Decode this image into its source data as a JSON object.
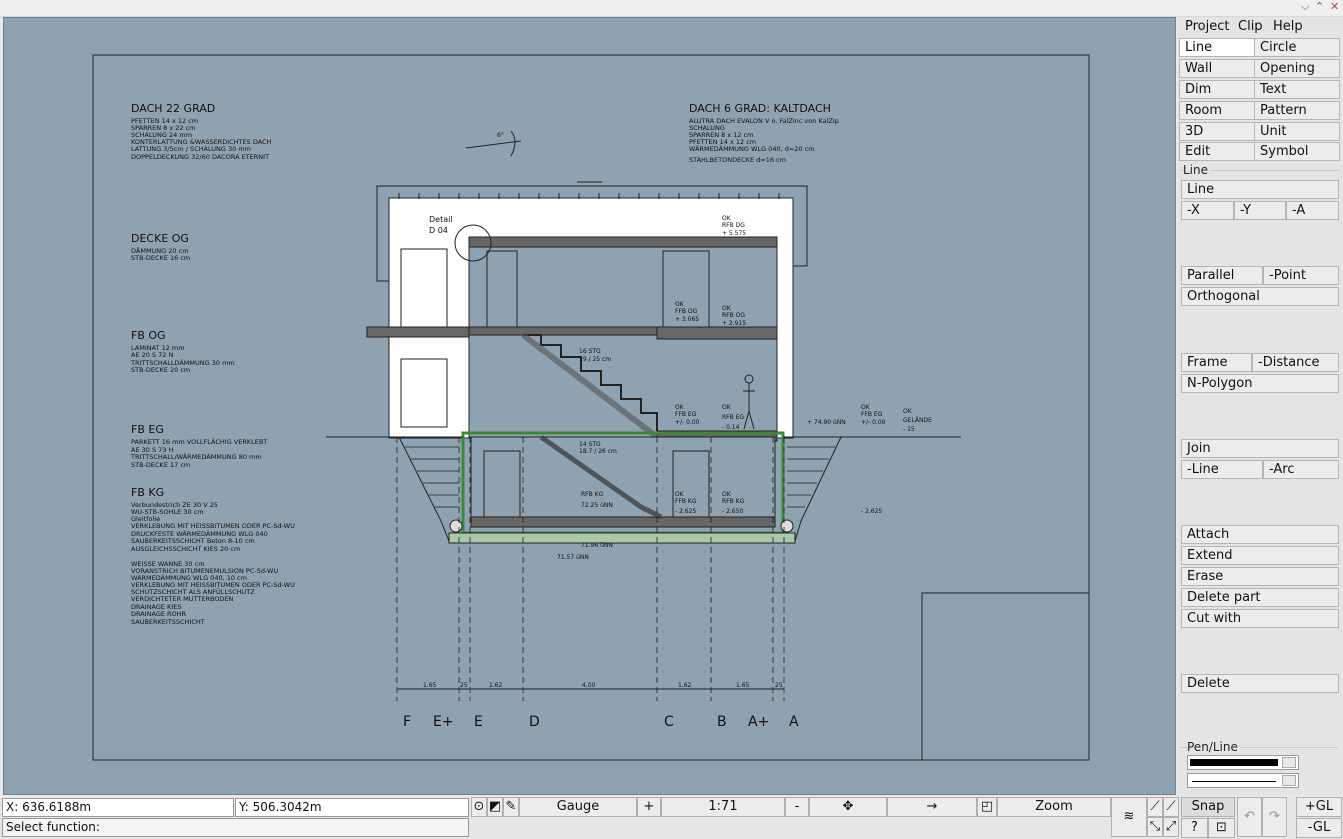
{
  "window_controls": [
    "⌵",
    "⌃",
    "✕"
  ],
  "drawing": {
    "roof_left": {
      "heading": "DACH 22 GRAD",
      "lines": [
        "PFETTEN 14 x 12 cm",
        "SPARREN 8 x 22 cm",
        "SCHALUNG 24 mm",
        "KONTERLATTUNG &WASSERDICHTES DACH",
        "LATTUNG 3/5cm / SCHALUNG 30 mm",
        "DOPPELDECKUNG 32/60 DACORA ETERNIT"
      ]
    },
    "roof_right": {
      "heading": "DACH 6 GRAD: KALTDACH",
      "lines": [
        "ALUTRA DACH EVALON V o. FalZinc von KalZip",
        "SCHALUNG",
        "SPARREN 8 x 12 cm",
        "PFETTEN 14 x 12 cm",
        "WÄRMEDÄMMUNG WLG 040, d=20 cm",
        "STAHLBETONDECKE d=16 cm"
      ]
    },
    "decke_og": {
      "heading": "DECKE OG",
      "lines": [
        "DÄMMUNG 20 cm",
        "STB-DECKE 16 cm"
      ]
    },
    "fb_og": {
      "heading": "FB OG",
      "lines": [
        "LAMINAT 12 mm",
        "AE 20 S 72 N",
        "TRITTSCHALLDÄMMUNG 30 mm",
        "STB-DECKE 20 cm"
      ]
    },
    "fb_eg": {
      "heading": "FB EG",
      "lines": [
        "PARKETT 16 mm VOLLFLÄCHIG VERKLEBT",
        "AE 30 S 73 H",
        "TRITTSCHALL/WÄRMEDÄMMUNG 80 mm",
        "STB-DECKE 17 cm"
      ]
    },
    "fb_kg": {
      "heading": "FB KG",
      "lines": [
        "Verbundestrich ZE 30 V 25",
        "WU-STB-SOHLE 30 cm",
        "Gleitfolie",
        "VERKLEBUNG MIT HEISSBITUMEN ODER PC-Sd-WU",
        "DRUCKFESTE WÄRMEDÄMMUNG WLG 040",
        "SAUBERKEITSSCHICHT Beton 8-10 cm",
        "AUSGLEICHSSCHICHT KIES 20 cm",
        "",
        "WEISSE WANNE 30 cm",
        "VORANSTRICH BITUMENEMULSION PC-Sd-WU",
        "WÄRMEDÄMMUNG WLG 040, 10 cm",
        "VERKLEBUNG MIT HEISSBITUMEN ODER PC-Sd-WU",
        "SCHUTZSCHICHT ALS ANFÜLLSCHUTZ",
        "VERDICHTETER MUTTERBODEN",
        "DRAINAGE KIES",
        "DRAINAGE ROHR",
        "SAUBERKEITSSCHICHT"
      ]
    },
    "detail": [
      "Detail",
      "D 04"
    ],
    "roof_angle": "6°",
    "levels": {
      "rfb_dg": [
        "OK",
        "RFB DG",
        "+ 5.575"
      ],
      "ffb_og": [
        "OK",
        "FFB OG",
        "+ 3.065"
      ],
      "rfb_og": [
        "OK",
        "RFB OG",
        "+ 2.915"
      ],
      "ffb_eg": [
        "OK",
        "FFB EG",
        "+/- 0.00"
      ],
      "rfb_eg": [
        "OK",
        "RFB EG",
        "- 0.14"
      ],
      "rfb_kg_nn": [
        "RFB KG",
        "72.25 üNN"
      ],
      "ffb_kg": [
        "OK",
        "FFB KG",
        "- 2.625"
      ],
      "rfb_kg": [
        "OK",
        "RFB KG",
        "- 2.650"
      ],
      "nn_74": "+ 74.90 üNN",
      "ffb_eg_r": [
        "OK",
        "FFB EG",
        "+/- 0.00"
      ],
      "gelaende": [
        "OK",
        "GELÄNDE",
        "- 15"
      ],
      "minus_2625": "- 2.625",
      "nn_7196": "71.96 üNN",
      "nn_7157": "71.57 üNN"
    },
    "stairs": {
      "upper": [
        "16 STG",
        "19 / 25 cm"
      ],
      "lower": [
        "14 STG",
        "18.7 / 26 cm"
      ]
    },
    "dimensions": [
      "1.65",
      "25",
      "1.62",
      "4.00",
      "1.62",
      "1.65",
      "25"
    ],
    "axes": [
      "F",
      "E+",
      "E",
      "D",
      "C",
      "B",
      "A+",
      "A"
    ]
  },
  "menu": [
    "Project",
    "Clip",
    "Help"
  ],
  "tools": [
    [
      "Line",
      "Circle"
    ],
    [
      "Wall",
      "Opening"
    ],
    [
      "Dim",
      "Text"
    ],
    [
      "Room",
      "Pattern"
    ],
    [
      "3D",
      "Unit"
    ],
    [
      "Edit",
      "Symbol"
    ]
  ],
  "line_section": {
    "title": "Line",
    "line": "Line",
    "axis_buttons": [
      "-X",
      "-Y",
      "-A"
    ],
    "parallel": "Parallel",
    "point": "-Point",
    "orthogonal": "Orthogonal",
    "frame": "Frame",
    "distance": "-Distance",
    "npolygon": "N-Polygon",
    "join": "Join",
    "join_line": "-Line",
    "join_arc": "-Arc",
    "attach": "Attach",
    "extend": "Extend",
    "erase": "Erase",
    "delete_part": "Delete part",
    "cut_with": "Cut with",
    "delete": "Delete"
  },
  "pen": {
    "title": "Pen/Line"
  },
  "status": {
    "x": "X: 636.6188m",
    "y": "Y: 506.3042m",
    "prompt": "Select function:",
    "gauge": "Gauge",
    "plus": "+",
    "scale": "1:71",
    "minus": "-",
    "zoom": "Zoom",
    "snap": "Snap",
    "help": "?",
    "plus_gl": "+GL",
    "minus_gl": "-GL"
  }
}
